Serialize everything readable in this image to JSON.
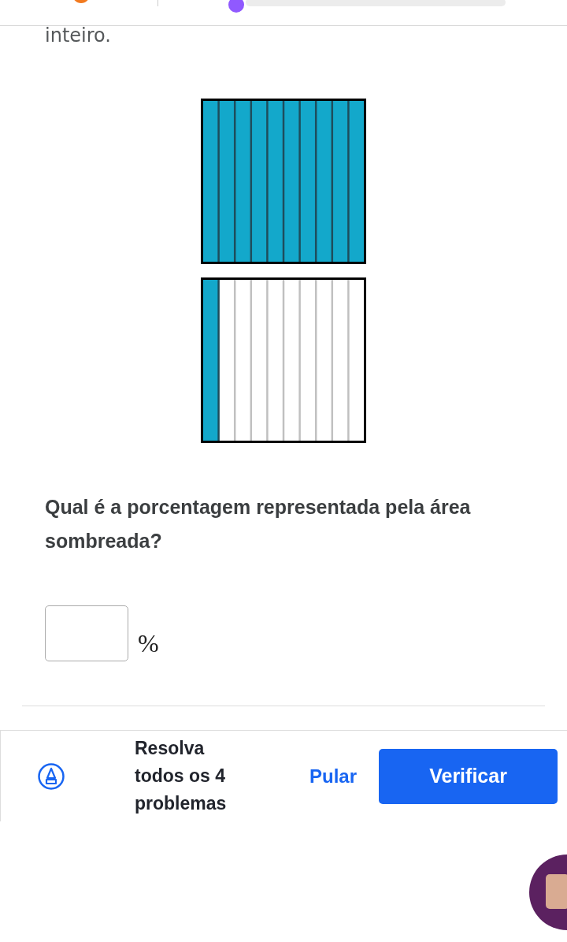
{
  "prompt_tail": "inteiro.",
  "grids": [
    {
      "strips": [
        {
          "shaded": true
        },
        {
          "shaded": true
        },
        {
          "shaded": true
        },
        {
          "shaded": true
        },
        {
          "shaded": true
        },
        {
          "shaded": true
        },
        {
          "shaded": true
        },
        {
          "shaded": true
        },
        {
          "shaded": true
        },
        {
          "shaded": true
        }
      ]
    },
    {
      "strips": [
        {
          "shaded": true
        },
        {
          "shaded": false
        },
        {
          "shaded": false
        },
        {
          "shaded": false
        },
        {
          "shaded": false
        },
        {
          "shaded": false
        },
        {
          "shaded": false
        },
        {
          "shaded": false
        },
        {
          "shaded": false
        },
        {
          "shaded": false
        }
      ]
    }
  ],
  "question": "Qual é a porcentagem representada pela área sombreada?",
  "answer": {
    "unit": "%"
  },
  "footer": {
    "message": "Resolva todos os 4 problemas",
    "skip": "Pular",
    "check": "Verificar"
  }
}
